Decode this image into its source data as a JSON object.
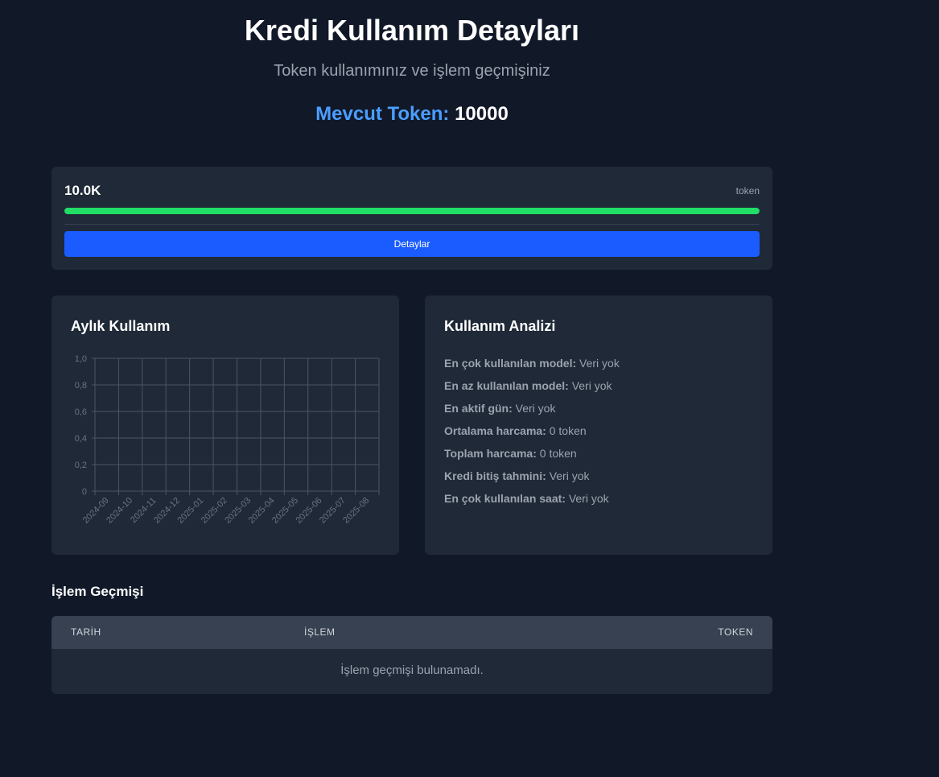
{
  "header": {
    "title": "Kredi Kullanım Detayları",
    "subtitle": "Token kullanımınız ve işlem geçmişiniz",
    "balance_label": "Mevcut Token:",
    "balance_value": "10000"
  },
  "token_card": {
    "amount": "10.0K",
    "unit": "token",
    "progress_fraction": 1.0,
    "details_button": "Detaylar"
  },
  "monthly": {
    "title": "Aylık Kullanım"
  },
  "chart_data": {
    "type": "line",
    "title": "Aylık Kullanım",
    "categories": [
      "2024-09",
      "2024-10",
      "2024-11",
      "2024-12",
      "2025-01",
      "2025-02",
      "2025-03",
      "2025-04",
      "2025-05",
      "2025-06",
      "2025-07",
      "2025-08"
    ],
    "y_ticks": [
      "1,0",
      "0,8",
      "0,6",
      "0,4",
      "0,2",
      "0"
    ],
    "ylim": [
      0,
      1
    ],
    "series": [],
    "grid": true
  },
  "analysis": {
    "title": "Kullanım Analizi",
    "items": [
      {
        "label": "En çok kullanılan model:",
        "value": "Veri yok"
      },
      {
        "label": "En az kullanılan model:",
        "value": "Veri yok"
      },
      {
        "label": "En aktif gün:",
        "value": "Veri yok"
      },
      {
        "label": "Ortalama harcama:",
        "value": "0 token"
      },
      {
        "label": "Toplam harcama:",
        "value": "0 token"
      },
      {
        "label": "Kredi bitiş tahmini:",
        "value": "Veri yok"
      },
      {
        "label": "En çok kullanılan saat:",
        "value": "Veri yok"
      }
    ]
  },
  "history": {
    "title": "İşlem Geçmişi",
    "columns": {
      "date": "TARİH",
      "operation": "İŞLEM",
      "token": "TOKEN"
    },
    "empty_message": "İşlem geçmişi bulunamadı."
  },
  "colors": {
    "background": "#111827",
    "card": "#1f2937",
    "accent_blue": "#4a9eff",
    "button_blue": "#1a5cff",
    "progress_green": "#22dd66"
  }
}
